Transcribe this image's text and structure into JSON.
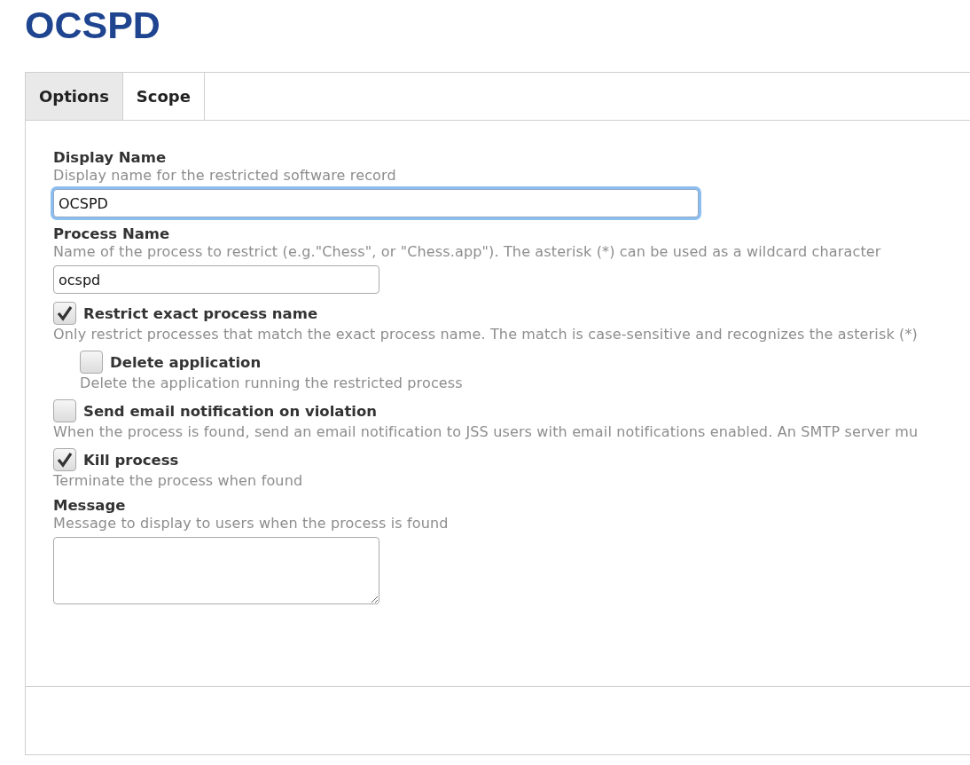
{
  "title": "OCSPD",
  "tabs": [
    {
      "label": "Options",
      "selected": true
    },
    {
      "label": "Scope",
      "selected": false
    }
  ],
  "fields": [
    {
      "kind": "text",
      "label": "Display Name",
      "hint": "Display name for the restricted software record",
      "value": "OCSPD",
      "focused": true,
      "wide": true
    },
    {
      "kind": "text",
      "label": "Process Name",
      "hint": "Name of the process to restrict (e.g.\"Chess\", or \"Chess.app\"). The asterisk (*) can be used as a wildcard character",
      "value": "ocspd",
      "focused": false,
      "wide": false
    },
    {
      "kind": "checkbox",
      "label": "Restrict exact process name",
      "hint": "Only restrict processes that match the exact process name. The match is case-sensitive and recognizes the asterisk (*)",
      "checked": true,
      "children": [
        {
          "kind": "checkbox",
          "label": "Delete application",
          "hint": "Delete the application running the restricted process",
          "checked": false
        }
      ]
    },
    {
      "kind": "checkbox",
      "label": "Send email notification on violation",
      "hint": "When the process is found, send an email notification to JSS users with email notifications enabled. An SMTP server mu",
      "checked": false
    },
    {
      "kind": "checkbox",
      "label": "Kill process",
      "hint": "Terminate the process when found",
      "checked": true
    },
    {
      "kind": "textarea",
      "label": "Message",
      "hint": "Message to display to users when the process is found"
    }
  ]
}
